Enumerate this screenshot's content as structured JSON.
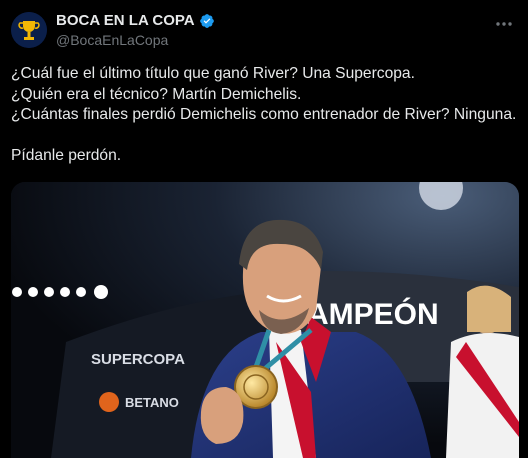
{
  "author": {
    "display_name": "BOCA EN LA COPA",
    "handle": "@BocaEnLaCopa",
    "avatar_icon": "trophy-icon",
    "verified_icon": "verified-badge-icon"
  },
  "menu": {
    "icon": "more-options-icon"
  },
  "tweet": {
    "lines": [
      "¿Cuál fue el último título que ganó River? Una Supercopa.",
      "¿Quién era el técnico? Martín Demichelis.",
      "¿Cuántas finales perdió Demichelis como entrenador de River? Ninguna.",
      "Pídanle perdón."
    ]
  },
  "media": {
    "banner_left": "SUPERCOPA",
    "banner_left_sub": "BETANO",
    "banner_right": "AMPEÓN"
  },
  "colors": {
    "background": "#000000",
    "text": "#e7e9ea",
    "muted": "#71767b",
    "verified": "#1d9bf0"
  }
}
